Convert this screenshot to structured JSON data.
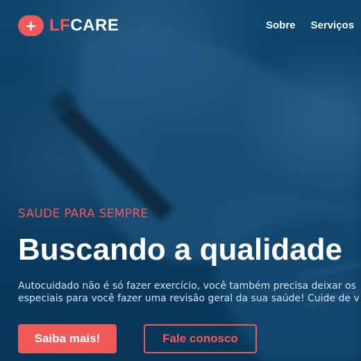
{
  "brand": {
    "logo_part1": "LF",
    "logo_part2": "CARE",
    "logo_symbol": "+",
    "accent_color": "#f25a5a",
    "icon": "plus-icon"
  },
  "nav": {
    "items": [
      {
        "label": "Sobre"
      },
      {
        "label": "Serviços"
      }
    ]
  },
  "hero": {
    "tagline": "SAUDE PARA SEMPRE",
    "headline": "Buscando a qualidade",
    "description_line1": "Autocuidado não é só fazer exercício, você também precisa deixar os",
    "description_line2": "especiais para você fazer uma revisão geral da sua saúde! Cuide de v",
    "primary_button": "Saiba mais!",
    "secondary_button": "Fale conosco"
  }
}
